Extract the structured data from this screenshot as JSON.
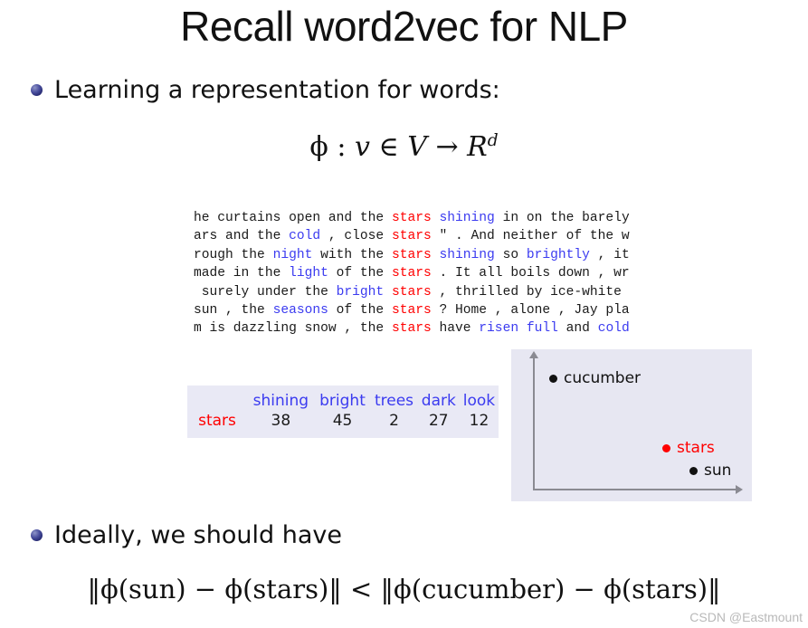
{
  "slide": {
    "title": "Recall word2vec for NLP",
    "watermark": "CSDN @Eastmount"
  },
  "bullets": [
    {
      "label": "Learning a representation for words:"
    },
    {
      "label": "Ideally, we should have"
    }
  ],
  "math": {
    "mapping": {
      "phi": "ϕ",
      "colon": " : ",
      "v": "v",
      "in": " ∈ ",
      "V": "V",
      "arrow": " → ",
      "R": "R",
      "d": "d"
    },
    "inequality": "‖ϕ(sun) − ϕ(stars)‖ < ‖ϕ(cucumber) − ϕ(stars)‖"
  },
  "corpus": {
    "target_word": "stars",
    "lines": [
      [
        {
          "t": "he curtains open and the ",
          "c": "plain"
        },
        {
          "t": "stars",
          "c": "target"
        },
        {
          "t": " ",
          "c": "plain"
        },
        {
          "t": "shining",
          "c": "context"
        },
        {
          "t": " in on the barely",
          "c": "plain"
        }
      ],
      [
        {
          "t": "ars and the ",
          "c": "plain"
        },
        {
          "t": "cold",
          "c": "context"
        },
        {
          "t": " , close ",
          "c": "plain"
        },
        {
          "t": "stars",
          "c": "target"
        },
        {
          "t": " \" . And neither of the w",
          "c": "plain"
        }
      ],
      [
        {
          "t": "rough the ",
          "c": "plain"
        },
        {
          "t": "night",
          "c": "context"
        },
        {
          "t": " with the ",
          "c": "plain"
        },
        {
          "t": "stars",
          "c": "target"
        },
        {
          "t": " ",
          "c": "plain"
        },
        {
          "t": "shining",
          "c": "context"
        },
        {
          "t": " so ",
          "c": "plain"
        },
        {
          "t": "brightly",
          "c": "context"
        },
        {
          "t": " , it",
          "c": "plain"
        }
      ],
      [
        {
          "t": "made in the ",
          "c": "plain"
        },
        {
          "t": "light",
          "c": "context"
        },
        {
          "t": " of the ",
          "c": "plain"
        },
        {
          "t": "stars",
          "c": "target"
        },
        {
          "t": " . It all boils down , wr",
          "c": "plain"
        }
      ],
      [
        {
          "t": " surely under the ",
          "c": "plain"
        },
        {
          "t": "bright",
          "c": "context"
        },
        {
          "t": " ",
          "c": "plain"
        },
        {
          "t": "stars",
          "c": "target"
        },
        {
          "t": " , thrilled by ice-white",
          "c": "plain"
        }
      ],
      [
        {
          "t": "sun , the ",
          "c": "plain"
        },
        {
          "t": "seasons",
          "c": "context"
        },
        {
          "t": " of the ",
          "c": "plain"
        },
        {
          "t": "stars",
          "c": "target"
        },
        {
          "t": " ? Home , alone , Jay pla",
          "c": "plain"
        }
      ],
      [
        {
          "t": "m is dazzling snow , the ",
          "c": "plain"
        },
        {
          "t": "stars",
          "c": "target"
        },
        {
          "t": " have ",
          "c": "plain"
        },
        {
          "t": "risen",
          "c": "context"
        },
        {
          "t": " ",
          "c": "plain"
        },
        {
          "t": "full",
          "c": "context"
        },
        {
          "t": " and ",
          "c": "plain"
        },
        {
          "t": "cold",
          "c": "context"
        }
      ]
    ]
  },
  "count_table": {
    "corner": "",
    "columns": [
      "shining",
      "bright",
      "trees",
      "dark",
      "look"
    ],
    "row_label": "stars",
    "values": [
      38,
      45,
      2,
      27,
      12
    ]
  },
  "chart_data": {
    "type": "scatter",
    "title": "",
    "xlabel": "",
    "ylabel": "",
    "grid": false,
    "legend": "none",
    "axis_style": "arrows",
    "points": [
      {
        "label": "cucumber",
        "x": 0.18,
        "y": 0.86,
        "color": "#111111"
      },
      {
        "label": "stars",
        "x": 0.66,
        "y": 0.4,
        "color": "#ff0000"
      },
      {
        "label": "sun",
        "x": 0.78,
        "y": 0.26,
        "color": "#111111"
      }
    ]
  },
  "colors": {
    "target_red": "#ff0000",
    "context_blue": "#3b3bf0",
    "panel_lavender": "#e7e7f2",
    "table_lavender": "#e9e9f5",
    "axis_gray": "#8a8a92",
    "bullet_navy": "#262a72"
  }
}
